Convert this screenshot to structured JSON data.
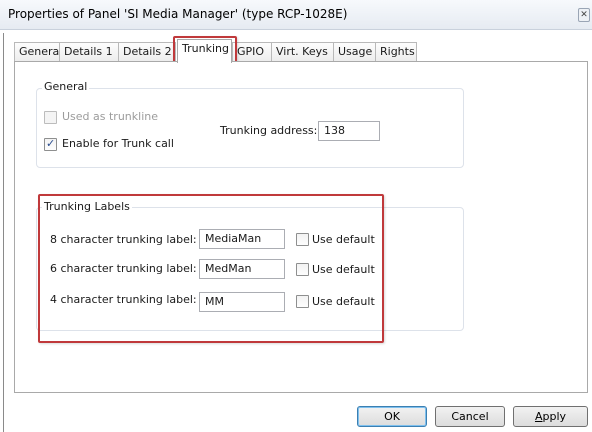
{
  "window": {
    "title": "Properties of Panel 'SI Media Manager' (type RCP-1028E)",
    "close_glyph": "✕"
  },
  "tabs": [
    {
      "label": "General"
    },
    {
      "label": "Details 1"
    },
    {
      "label": "Details 2"
    },
    {
      "label": "Trunking"
    },
    {
      "label": "GPIO"
    },
    {
      "label": "Virt. Keys"
    },
    {
      "label": "Usage"
    },
    {
      "label": "Rights"
    }
  ],
  "active_tab": "Trunking",
  "general_group": {
    "title": "General",
    "used_as_trunkline": {
      "label": "Used as trunkline",
      "checked": false,
      "enabled": false
    },
    "enable_trunk_call": {
      "label": "Enable for Trunk call",
      "checked": true,
      "enabled": true
    },
    "trunking_address": {
      "label": "Trunking address:",
      "value": "138"
    }
  },
  "labels_group": {
    "title": "Trunking Labels",
    "rows": [
      {
        "label": "8 character trunking label:",
        "value": "MediaMan",
        "use_default_label": "Use default",
        "use_default_checked": false
      },
      {
        "label": "6 character trunking label:",
        "value": "MedMan",
        "use_default_label": "Use default",
        "use_default_checked": false
      },
      {
        "label": "4 character trunking label:",
        "value": "MM",
        "use_default_label": "Use default",
        "use_default_checked": false
      }
    ]
  },
  "buttons": {
    "ok": "OK",
    "cancel": "Cancel",
    "apply": "Apply"
  },
  "colors": {
    "highlight": "#c0393b",
    "default_button_border": "#3c7fb1"
  }
}
